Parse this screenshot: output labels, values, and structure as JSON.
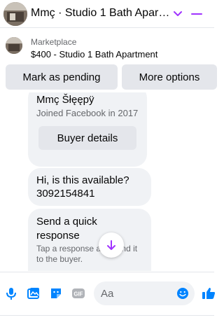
{
  "header": {
    "title": "Mmç · Studio 1 Bath Apart…",
    "icons": [
      "chevron-down-icon",
      "minimize-icon"
    ],
    "accent": "#a033ff"
  },
  "marketplace": {
    "label": "Marketplace",
    "title": "$400 - Studio 1 Bath Apartment"
  },
  "actions": {
    "pending_label": "Mark as pending",
    "more_label": "More options"
  },
  "messages": {
    "profile_name": "Mmç Šłęępÿ",
    "profile_joined": "Joined Facebook in 2017",
    "buyer_button": "Buyer details",
    "msg_line1": "Hi, is this available?",
    "msg_line2": "3092154841",
    "quick_title": "Send a quick response",
    "quick_sub": "Tap a response and send it to the buyer."
  },
  "composer": {
    "placeholder": "Aa",
    "icon_color": "#0084ff",
    "icons": [
      "microphone-icon",
      "photo-icon",
      "sticker-icon",
      "gif-icon",
      "emoji-icon",
      "like-icon"
    ]
  }
}
